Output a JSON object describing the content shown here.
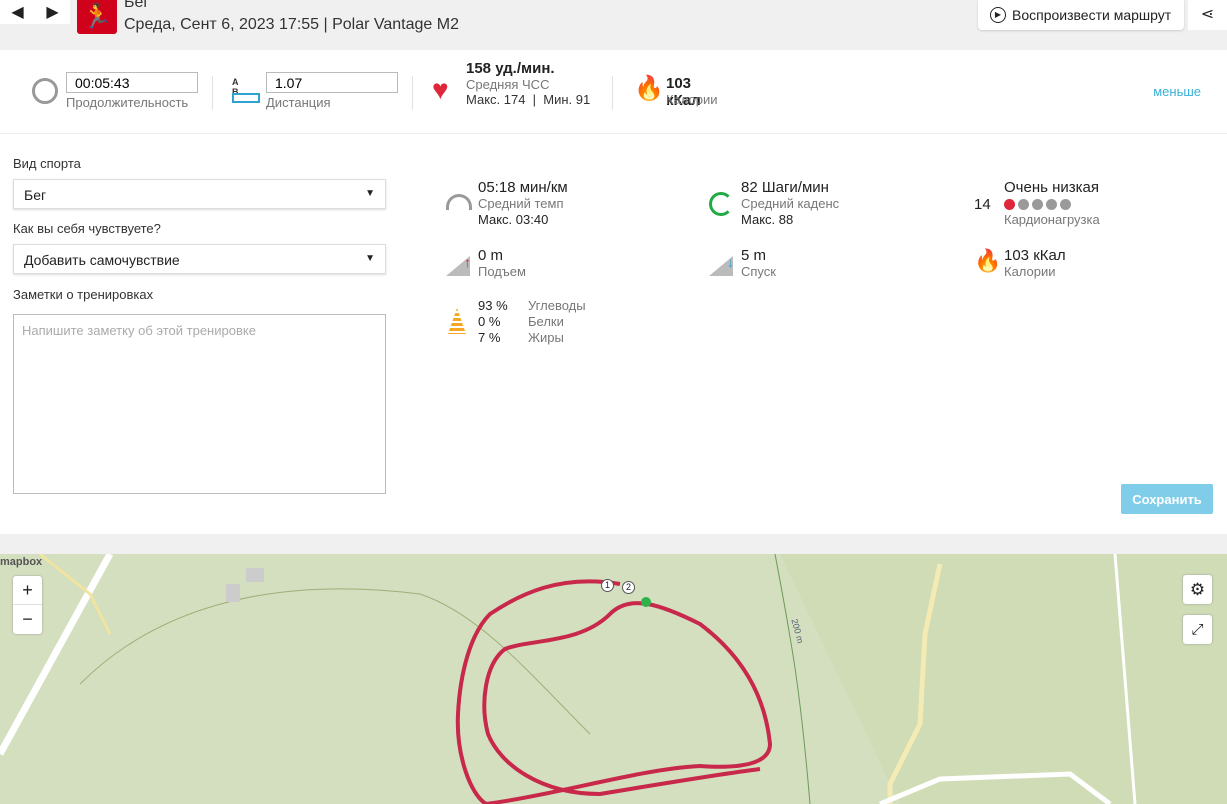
{
  "header": {
    "prev": "◀",
    "next": "▶",
    "title": "Бег",
    "subtitle": "Среда, Сент 6, 2023 17:55 | Polar Vantage M2",
    "replay": "Воспроизвести маршрут",
    "share": "share"
  },
  "summary": {
    "duration_value": "00:05:43",
    "duration_label": "Продолжительность",
    "ab_a": "A",
    "ab_b": "B",
    "distance_value": "1.07",
    "distance_label": "Дистанция",
    "hr_value": "158 уд./мин.",
    "hr_label": "Средняя ЧСС",
    "hr_minmax": "Макс. 174  |  Мин. 91",
    "cal_value": "103 кКал",
    "cal_label": "Калории",
    "less": "меньше"
  },
  "form": {
    "sport_label": "Вид спорта",
    "sport_value": "Бег",
    "feel_label": "Как вы себя чувствуете?",
    "feel_value": "Добавить самочувствие",
    "notes_label": "Заметки о тренировках",
    "notes_placeholder": "Напишите заметку об этой тренировке",
    "save": "Сохранить"
  },
  "stats": {
    "pace_value": "05:18 мин/км",
    "pace_label": "Средний темп",
    "pace_max": "Макс. 03:40",
    "cad_value": "82 Шаги/мин",
    "cad_label": "Средний каденс",
    "cad_max": "Макс. 88",
    "load_value": "Очень низкая",
    "load_num": "14",
    "load_label": "Кардионагрузка",
    "load_level": 1,
    "load_max": 5,
    "ascent_value": "0 m",
    "ascent_label": "Подъем",
    "descent_value": "5 m",
    "descent_label": "Спуск",
    "cal_value": "103 кКал",
    "cal_label": "Калории",
    "carb_pct": "93 %",
    "carb_label": "Углеводы",
    "prot_pct": "0 %",
    "prot_label": "Белки",
    "fat_pct": "7 %",
    "fat_label": "Жиры"
  },
  "map": {
    "logo": "mapbox",
    "zoom_in": "+",
    "zoom_out": "−",
    "contour": "200 m",
    "marker1": "1",
    "marker2": "2"
  },
  "colors": {
    "accent": "#d0021b",
    "link": "#3ab0d8",
    "route": "#c8284a"
  }
}
